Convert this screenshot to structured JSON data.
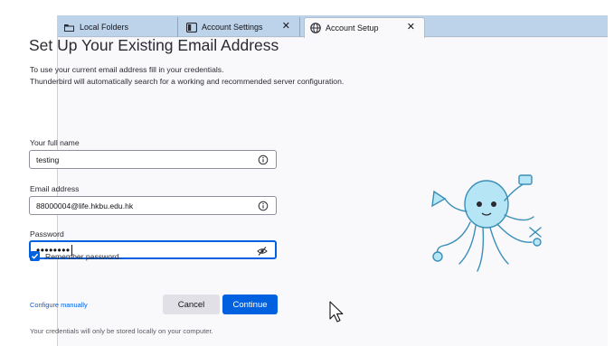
{
  "tabs": [
    {
      "label": "Local Folders",
      "icon": "folder-icon",
      "closable": false
    },
    {
      "label": "Account Settings",
      "icon": "settings-window-icon",
      "closable": true
    },
    {
      "label": "Account Setup",
      "icon": "globe-icon",
      "closable": true,
      "active": true
    }
  ],
  "setup": {
    "title": "Set Up Your Existing Email Address",
    "intro_line1": "To use your current email address fill in your credentials.",
    "intro_line2": "Thunderbird will automatically search for a working and recommended server configuration.",
    "full_name_label": "Your full name",
    "full_name_value": "testing",
    "email_label": "Email address",
    "email_value": "88000004@life.hkbu.edu.hk",
    "password_label": "Password",
    "password_value": "••••••••",
    "remember_label": "Remember password",
    "remember_checked": true,
    "configure_manually": "Configure manually",
    "cancel_label": "Cancel",
    "continue_label": "Continue",
    "footnote": "Your credentials will only be stored locally on your computer."
  },
  "colors": {
    "accent": "#0061e0",
    "tabbar": "#bcd3ea",
    "mascot": "#7ed3ee"
  }
}
